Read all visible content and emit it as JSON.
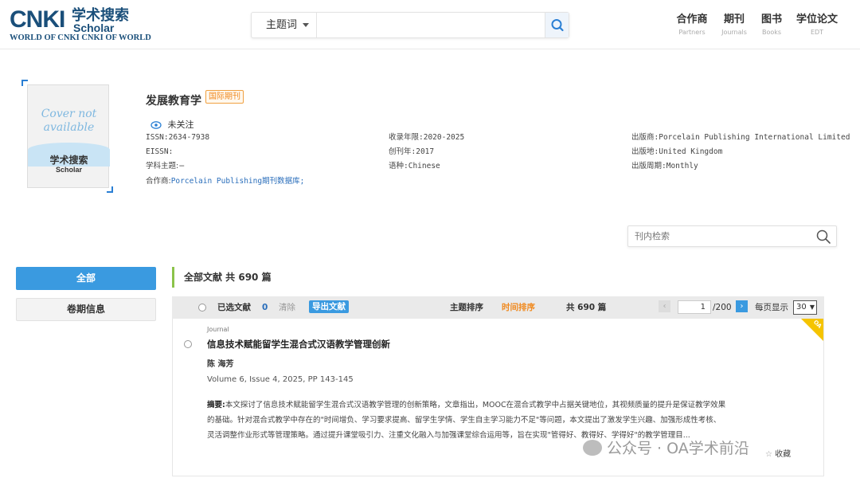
{
  "header": {
    "logo": {
      "big": "CNKI",
      "cn": "学术搜索",
      "scholar": "Scholar",
      "tagline": "WORLD OF CNKI CNKI OF WORLD"
    },
    "search": {
      "field": "主题词",
      "placeholder": ""
    },
    "nav": [
      {
        "label": "合作商",
        "sub": "Partners"
      },
      {
        "label": "期刊",
        "sub": "Journals"
      },
      {
        "label": "图书",
        "sub": "Books"
      },
      {
        "label": "学位论文",
        "sub": "EDT"
      }
    ]
  },
  "journal": {
    "cover_text": "Cover not available",
    "cover_logo_cn": "学术搜索",
    "cover_logo_en": "Scholar",
    "title": "发展教育学",
    "tag": "国际期刊",
    "follow": "未关注",
    "issn": "ISSN:2634-7938",
    "eissn": "EISSN:",
    "subject": "学科主题:−",
    "partner_label": "合作商:",
    "partner": "Porcelain Publishing期刊数据库;",
    "years": "收录年限:2020-2025",
    "founded": "创刊年:2017",
    "language": "语种:Chinese",
    "publisher": "出版商:Porcelain Publishing International Limited",
    "place": "出版地:United Kingdom",
    "cycle": "出版周期:Monthly",
    "inner_search_placeholder": "刊内检索"
  },
  "sidebar": {
    "all": "全部",
    "volumes": "卷期信息"
  },
  "results": {
    "total_label": "全部文献 共 690 篇",
    "toolbar": {
      "selected_label": "已选文献",
      "selected_count": "0",
      "clear": "清除",
      "export": "导出文献",
      "sort_topic": "主题排序",
      "sort_time": "时间排序",
      "count": "共 690 篇",
      "page": "1",
      "pages": "/200",
      "per_page_label": "每页显示",
      "per_page": "30"
    },
    "items": [
      {
        "type": "Journal",
        "title": "信息技术赋能留学生混合式汉语教学管理创新",
        "author": "陈 海芳",
        "volume": "Volume 6, Issue 4, 2025, PP 143-145",
        "abstract_label": "摘要:",
        "abstract_l1": "本文探讨了信息技术赋能留学生混合式汉语教学管理的创新策略，文章指出，MOOC在混合式教学中占据关键地位，其视频质量的提升是保证教学效果",
        "abstract_l2": "的基础。针对混合式教学中存在的\"时间增负、学习要求提高、留学生学情、学生自主学习能力不足\"等问题，本文提出了激发学生兴趣、加强形成性考核、",
        "abstract_l3": "灵活调整作业形式等管理策略。通过提升课堂吸引力、注重文化融入与加强课堂综合运用等，旨在实现\"管得好、教得好、学得好\"的教学管理目...",
        "favorite": "收藏",
        "oa": "OA"
      }
    ]
  },
  "watermark": "公众号 · OA学术前沿",
  "colors": {
    "brand": "#1a4f7a",
    "accent": "#3a9ae0",
    "oa": "#f5c400",
    "sort_active": "#f08a20"
  }
}
